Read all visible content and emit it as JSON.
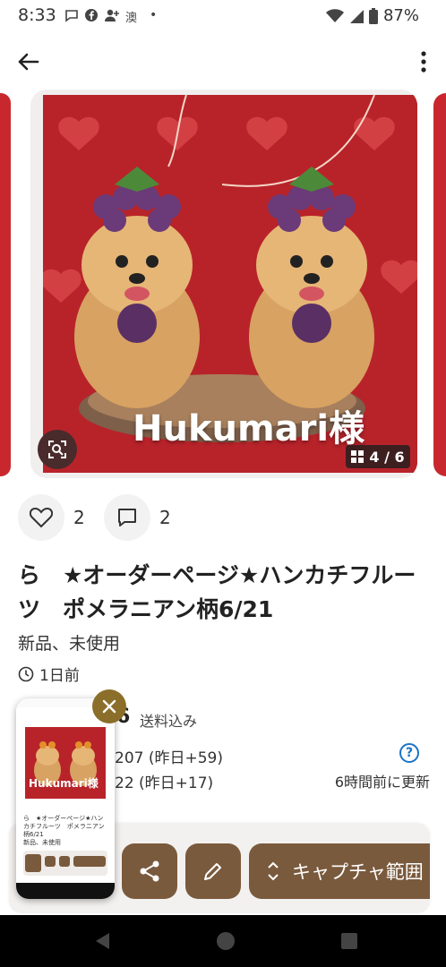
{
  "status": {
    "time": "8:33",
    "battery": "87%",
    "extra_icon_text": "澳",
    "dot": "•"
  },
  "product": {
    "image_counter": "4 / 6",
    "watermark": "Hukumari様",
    "likes": "2",
    "comments": "2",
    "title": "ら　★オーダーページ★ハンカチフルーツ　ポメラニアン柄6/21",
    "condition": "新品、未使用",
    "posted": "1日前",
    "price_partial": "6",
    "shipping": "送料込み",
    "stat_line1": "207 (昨日+59)",
    "stat_line2": "22 (昨日+17)",
    "updated": "6時間前に更新",
    "help_symbol": "?"
  },
  "actions": {
    "capture_label": "キャプチャ範囲"
  },
  "thumbnail": {
    "watermark": "Hukumari様",
    "title": "ら　★オーダーページ★ハンカチフルーツ　ポメラニアン柄6/21",
    "condition": "新品、未使用"
  },
  "colors": {
    "accent_brown": "#7a5a3d",
    "image_red": "#b8232a",
    "link_blue": "#1a73c8"
  }
}
